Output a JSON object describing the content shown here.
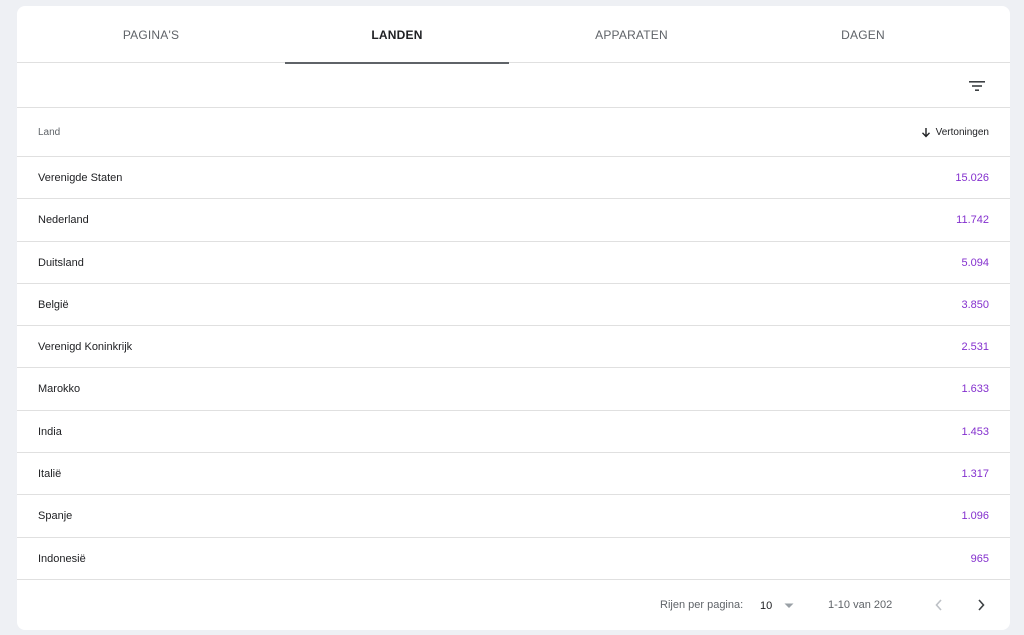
{
  "tabs": [
    {
      "label": "PAGINA'S",
      "active": false
    },
    {
      "label": "LANDEN",
      "active": true
    },
    {
      "label": "APPARATEN",
      "active": false
    },
    {
      "label": "DAGEN",
      "active": false
    }
  ],
  "table": {
    "col_country": "Land",
    "col_views": "Vertoningen",
    "sort_icon": "arrow-down-icon",
    "rows": [
      {
        "country": "Verenigde Staten",
        "views": "15.026"
      },
      {
        "country": "Nederland",
        "views": "11.742"
      },
      {
        "country": "Duitsland",
        "views": "5.094"
      },
      {
        "country": "België",
        "views": "3.850"
      },
      {
        "country": "Verenigd Koninkrijk",
        "views": "2.531"
      },
      {
        "country": "Marokko",
        "views": "1.633"
      },
      {
        "country": "India",
        "views": "1.453"
      },
      {
        "country": "Italië",
        "views": "1.317"
      },
      {
        "country": "Spanje",
        "views": "1.096"
      },
      {
        "country": "Indonesië",
        "views": "965"
      }
    ]
  },
  "footer": {
    "rows_per_page_label": "Rijen per pagina:",
    "rows_per_page_value": "10",
    "range": "1-10 van 202"
  },
  "colors": {
    "value": "#8430ce",
    "background": "#eef0f4",
    "divider": "#e0e0e0"
  }
}
